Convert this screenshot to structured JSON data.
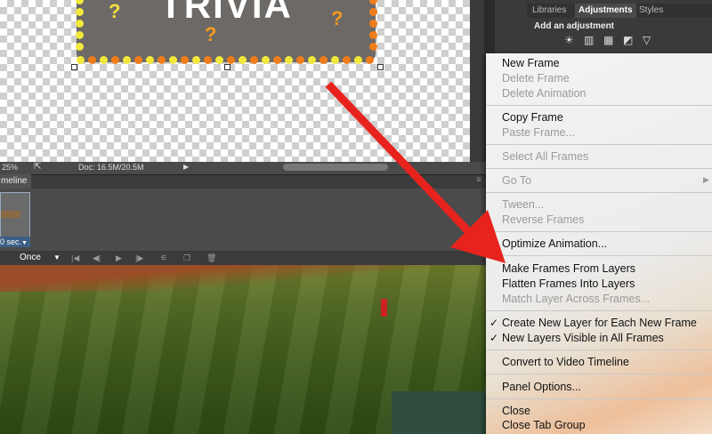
{
  "canvas": {
    "banner_title": "TRIVIA",
    "question_marks": [
      "?",
      "?",
      "?"
    ]
  },
  "status": {
    "zoom": "25%",
    "doc": "Doc: 16.5M/20.5M"
  },
  "timeline": {
    "tab_label": "meline",
    "frame_delay": "0 sec.",
    "loop_option": "Once"
  },
  "panel": {
    "tabs": [
      "Libraries",
      "Adjustments",
      "Styles"
    ],
    "active_tab": "Adjustments",
    "subtitle": "Add an adjustment"
  },
  "menu": {
    "new_frame": "New Frame",
    "delete_frame": "Delete Frame",
    "delete_animation": "Delete Animation",
    "copy_frame": "Copy Frame",
    "paste_frame": "Paste Frame...",
    "select_all_frames": "Select All Frames",
    "go_to": "Go To",
    "tween": "Tween...",
    "reverse_frames": "Reverse Frames",
    "optimize_animation": "Optimize Animation...",
    "make_frames_from_layers": "Make Frames From Layers",
    "flatten_frames_into_layers": "Flatten Frames Into Layers",
    "match_layer_across_frames": "Match Layer Across Frames...",
    "create_new_layer": "Create New Layer for Each New Frame",
    "new_layers_visible": "New Layers Visible in All Frames",
    "convert_to_video": "Convert to Video Timeline",
    "panel_options": "Panel Options...",
    "close": "Close",
    "close_tab_group": "Close Tab Group",
    "check_glyph": "✓"
  },
  "colors": {
    "arrow": "#e8231e",
    "menu_disabled": "#9a9a9a",
    "frame_delay_bg": "#3d5f84"
  }
}
